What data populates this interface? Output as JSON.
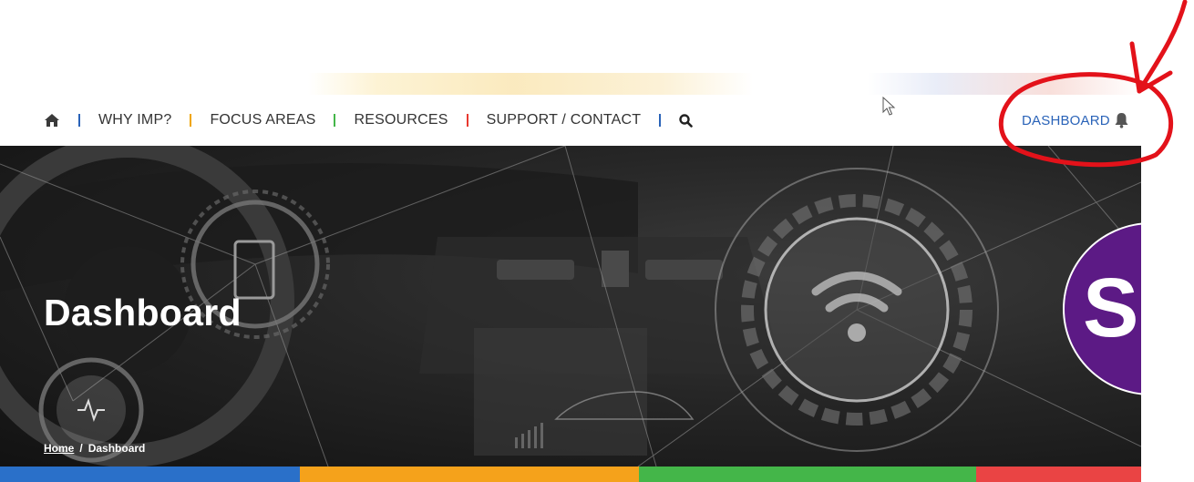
{
  "nav": {
    "items": [
      {
        "label": "WHY IMP?"
      },
      {
        "label": "FOCUS AREAS"
      },
      {
        "label": "RESOURCES"
      },
      {
        "label": "SUPPORT / CONTACT"
      }
    ],
    "separator_colors": [
      "#2a63b8",
      "#f0a500",
      "#44b649",
      "#e8392f",
      "#2a63b8"
    ],
    "dashboard_label": "DASHBOARD",
    "icons": {
      "home": "home-icon",
      "search": "search-icon",
      "bell": "bell-icon"
    }
  },
  "hero": {
    "title": "Dashboard",
    "breadcrumb": {
      "home": "Home",
      "separator": "/",
      "current": "Dashboard"
    },
    "badge_letter": "S",
    "badge_color": "#5c1a85"
  },
  "footer_bar_colors": [
    "#2a70c9",
    "#f5a21b",
    "#44b649",
    "#ea4444"
  ],
  "annotation": {
    "color": "#e3121a"
  }
}
